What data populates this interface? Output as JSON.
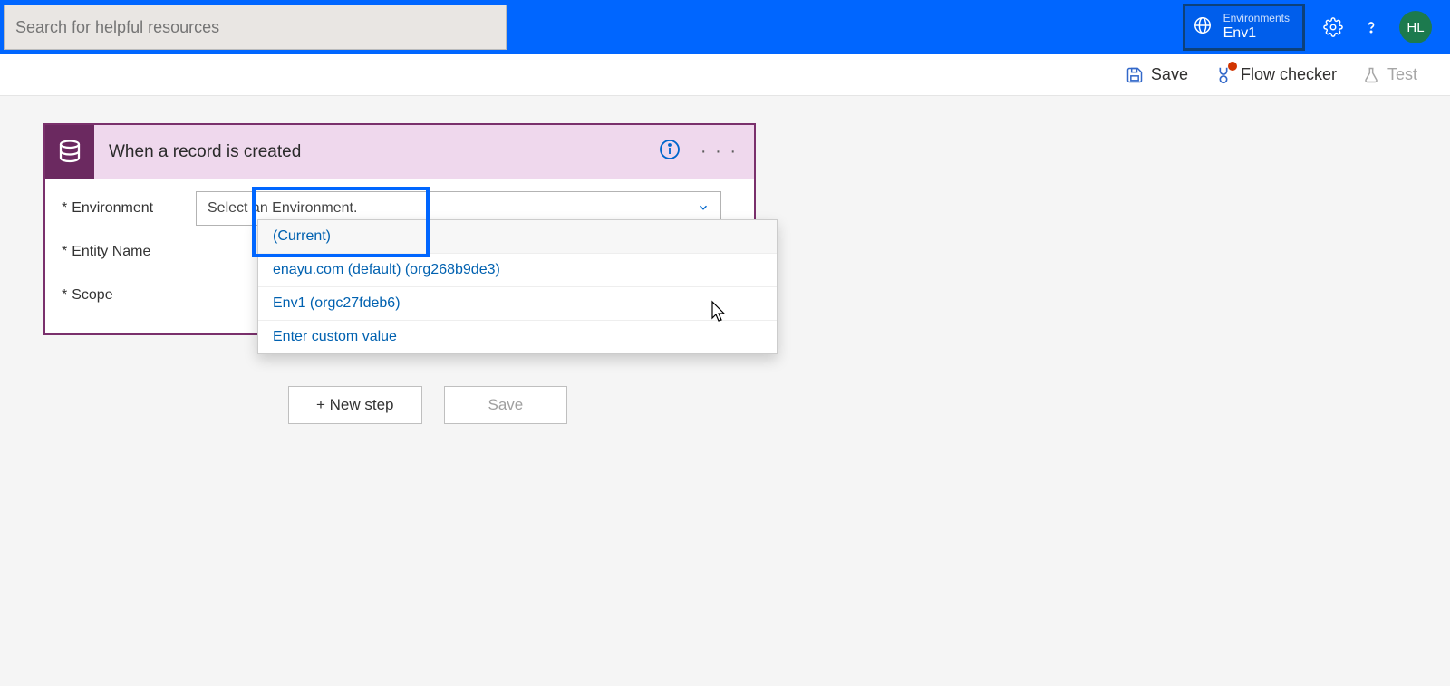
{
  "topbar": {
    "search_placeholder": "Search for helpful resources",
    "environment_label": "Environments",
    "environment_name": "Env1",
    "avatar_initials": "HL"
  },
  "actionbar": {
    "save": "Save",
    "flow_checker": "Flow checker",
    "test": "Test"
  },
  "trigger": {
    "title": "When a record is created",
    "fields": {
      "environment_label": "Environment",
      "entity_label": "Entity Name",
      "scope_label": "Scope"
    },
    "combo_placeholder": "Select an Environment.",
    "dropdown": {
      "current": "(Current)",
      "opt_default": "enayu.com (default) (org268b9de3)",
      "opt_env1": "Env1 (orgc27fdeb6)",
      "custom": "Enter custom value"
    }
  },
  "footer": {
    "new_step": "+ New step",
    "save": "Save"
  }
}
